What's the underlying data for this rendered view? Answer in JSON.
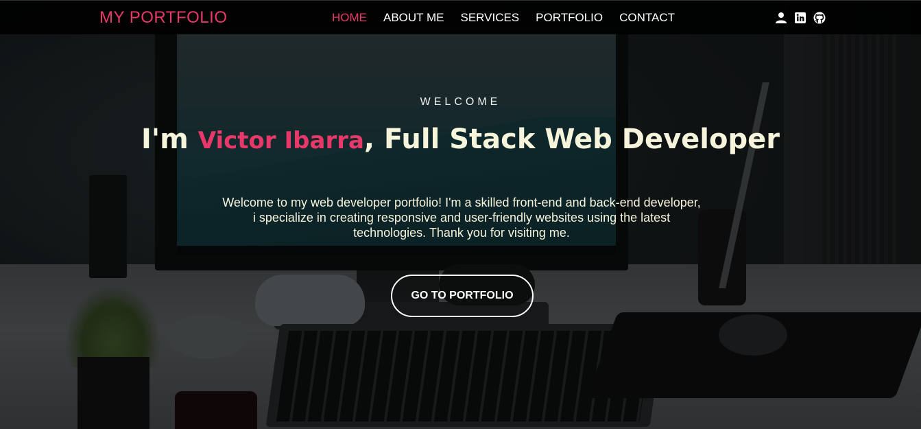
{
  "navbar": {
    "brand": "MY PORTFOLIO",
    "links": [
      {
        "label": "HOME",
        "active": true
      },
      {
        "label": "ABOUT ME",
        "active": false
      },
      {
        "label": "SERVICES",
        "active": false
      },
      {
        "label": "PORTFOLIO",
        "active": false
      },
      {
        "label": "CONTACT",
        "active": false
      }
    ],
    "social_icons": [
      "user-icon",
      "linkedin-icon",
      "github-icon"
    ]
  },
  "hero": {
    "eyebrow": "WELCOME",
    "headline_prefix": "I'm ",
    "headline_name": "Victor Ibarra",
    "headline_suffix": ", Full Stack Web Developer",
    "intro": "Welcome to my web developer portfolio! I'm a skilled front-end and back-end developer, i specialize in creating responsive and user-friendly websites using the latest technologies. Thank you for visiting me.",
    "cta_label": "GO TO PORTFOLIO"
  },
  "colors": {
    "accent": "#e8386a",
    "headline_text": "#f7f4dc",
    "navbar_bg": "#000000"
  }
}
